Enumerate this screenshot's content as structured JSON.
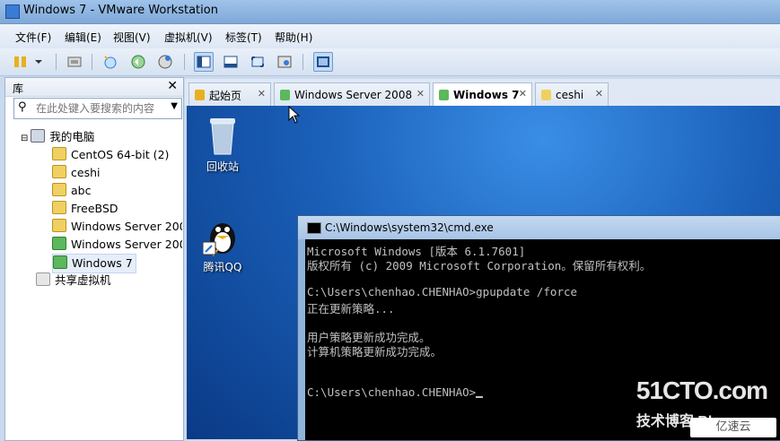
{
  "window": {
    "title": "Windows 7 - VMware Workstation"
  },
  "menu": [
    "文件(F)",
    "编辑(E)",
    "视图(V)",
    "虚拟机(V)",
    "标签(T)",
    "帮助(H)"
  ],
  "library": {
    "title": "库",
    "close": "✕",
    "search_placeholder": "在此处键入要搜索的内容",
    "root": "我的电脑",
    "items": [
      "CentOS 64-bit (2)",
      "ceshi",
      "abc",
      "FreeBSD",
      "Windows Server 200",
      "Windows Server 200",
      "Windows 7"
    ],
    "shared": "共享虚拟机"
  },
  "tabs": [
    {
      "label": "起始页",
      "close": "✕"
    },
    {
      "label": "Windows Server 2008",
      "close": "✕"
    },
    {
      "label": "Windows 7",
      "close": "✕"
    },
    {
      "label": "ceshi",
      "close": "✕"
    }
  ],
  "desktop": {
    "icons": [
      {
        "label": "回收站"
      },
      {
        "label": "腾讯QQ"
      }
    ]
  },
  "cmd": {
    "title": "C:\\Windows\\system32\\cmd.exe",
    "lines": [
      "Microsoft Windows [版本 6.1.7601]",
      "版权所有 (c) 2009 Microsoft Corporation。保留所有权利。",
      "",
      "C:\\Users\\chenhao.CHENHAO>gpupdate /force",
      "正在更新策略...",
      "",
      "用户策略更新成功完成。",
      "计算机策略更新成功完成。",
      "",
      "",
      "C:\\Users\\chenhao.CHENHAO>"
    ]
  },
  "watermark": {
    "main": "51CTO.com",
    "sub": "技术博客 Blog",
    "logo": "亿速云"
  },
  "colors": {
    "desktop": "#1a5fb8",
    "cmd_bg": "#000000",
    "accent": "#3a7bd5"
  }
}
